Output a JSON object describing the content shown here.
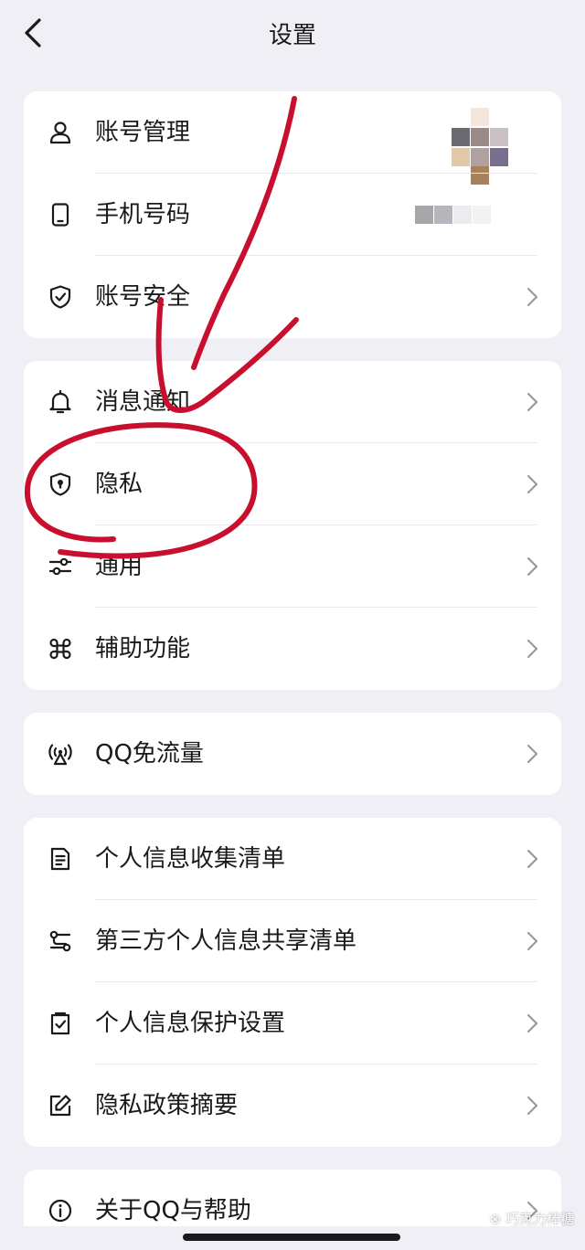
{
  "header": {
    "title": "设置"
  },
  "groups": [
    {
      "items": [
        {
          "label": "账号管理",
          "icon": "person-icon"
        },
        {
          "label": "手机号码",
          "icon": "phone-icon"
        },
        {
          "label": "账号安全",
          "icon": "shield-check-icon"
        }
      ]
    },
    {
      "items": [
        {
          "label": "消息通知",
          "icon": "bell-icon"
        },
        {
          "label": "隐私",
          "icon": "shield-lock-icon"
        },
        {
          "label": "通用",
          "icon": "sliders-icon"
        },
        {
          "label": "辅助功能",
          "icon": "command-icon"
        }
      ]
    },
    {
      "items": [
        {
          "label": "QQ免流量",
          "icon": "signal-tower-icon"
        }
      ]
    },
    {
      "items": [
        {
          "label": "个人信息收集清单",
          "icon": "document-list-icon"
        },
        {
          "label": "第三方个人信息共享清单",
          "icon": "share-nodes-icon"
        },
        {
          "label": "个人信息保护设置",
          "icon": "checkbox-icon"
        },
        {
          "label": "隐私政策摘要",
          "icon": "edit-icon"
        }
      ]
    },
    {
      "items": [
        {
          "label": "关于QQ与帮助",
          "icon": "info-icon"
        }
      ]
    }
  ],
  "watermark": "巧克力棒糖",
  "colors": {
    "background": "#f1eff6",
    "card": "#ffffff",
    "annotation": "#c8102e",
    "chevron": "#9a9a9a"
  }
}
